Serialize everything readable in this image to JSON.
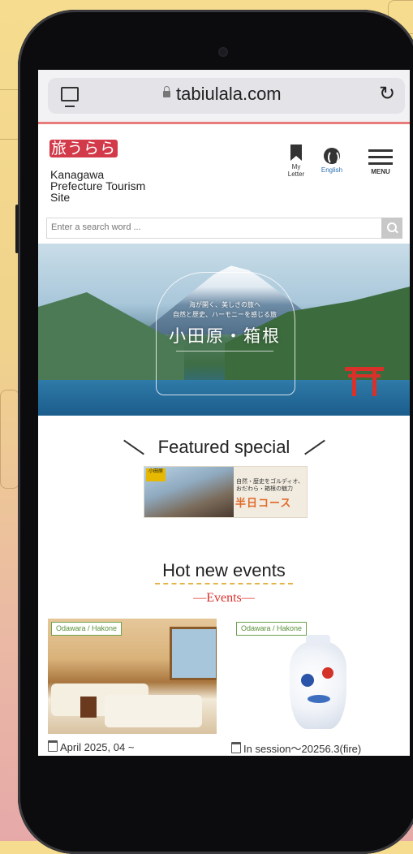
{
  "browser": {
    "url": "tabiulala.com"
  },
  "site": {
    "logo_text": "旅うらら",
    "name_line1": "Kanagawa",
    "name_line2": "Prefecture Tourism",
    "name_line3": "Site"
  },
  "header": {
    "my_letter_label_1": "My",
    "my_letter_label_2": "Letter",
    "english_label": "English",
    "menu_label": "MENU"
  },
  "search": {
    "placeholder": "Enter a search word ..."
  },
  "hero": {
    "caption_line1": "海が開く、美しさの旅へ",
    "caption_line2": "自然と歴史、ハーモニーを感じる旅",
    "title": "小田原・箱根"
  },
  "featured": {
    "title": "Featured special",
    "banner_tag": "小田原",
    "banner_text_1": "自然・歴史をゴルディオ、",
    "banner_text_2": "おだわら・箱根の魅力",
    "banner_course": "半日コース"
  },
  "events": {
    "title": "Hot new events",
    "subtitle": "—Events—",
    "cards": [
      {
        "tag": "Odawara / Hakone",
        "date": "April 2025, 04 ~"
      },
      {
        "tag": "Odawara / Hakone",
        "date": "In session～20256.3(fire)"
      }
    ]
  },
  "colors": {
    "accent_red": "#d9322b",
    "tag_green": "#5b8f3a",
    "underline_gold": "#e4b44a"
  }
}
